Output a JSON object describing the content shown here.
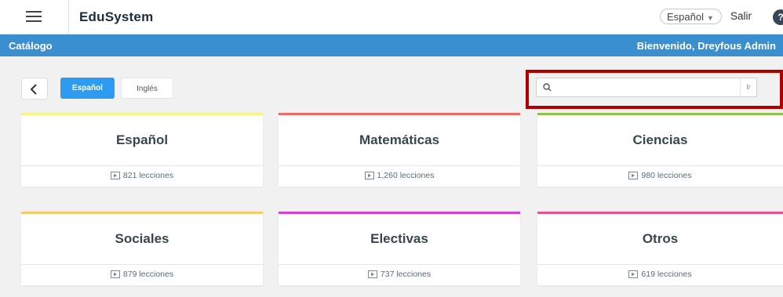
{
  "header": {
    "app_title": "EduSystem",
    "language_select": "Español",
    "logout_label": "Salir",
    "help_label": "?"
  },
  "subheader": {
    "section_title": "Catálogo",
    "welcome_text": "Bienvenido, Dreyfous Admin"
  },
  "toolbar": {
    "tabs": [
      {
        "label": "Español",
        "active": true
      },
      {
        "label": "Inglés",
        "active": false
      }
    ],
    "search": {
      "value": "",
      "placeholder": "",
      "go_label": "Ir"
    }
  },
  "catalog": [
    {
      "name": "Español",
      "count": "821 lecciones",
      "color": "#f7f28a"
    },
    {
      "name": "Matemáticas",
      "count": "1,260 lecciones",
      "color": "#ef6b62"
    },
    {
      "name": "Ciencias",
      "count": "980 lecciones",
      "color": "#8fc24a"
    },
    {
      "name": "Sociales",
      "count": "879 lecciones",
      "color": "#f9c96a"
    },
    {
      "name": "Electivas",
      "count": "737 lecciones",
      "color": "#d63fd8"
    },
    {
      "name": "Otros",
      "count": "619 lecciones",
      "color": "#ef4f91"
    }
  ],
  "colors": {
    "accent_blue": "#3a8fd0",
    "active_tab": "#2d9cf0",
    "highlight": "#b00000"
  }
}
